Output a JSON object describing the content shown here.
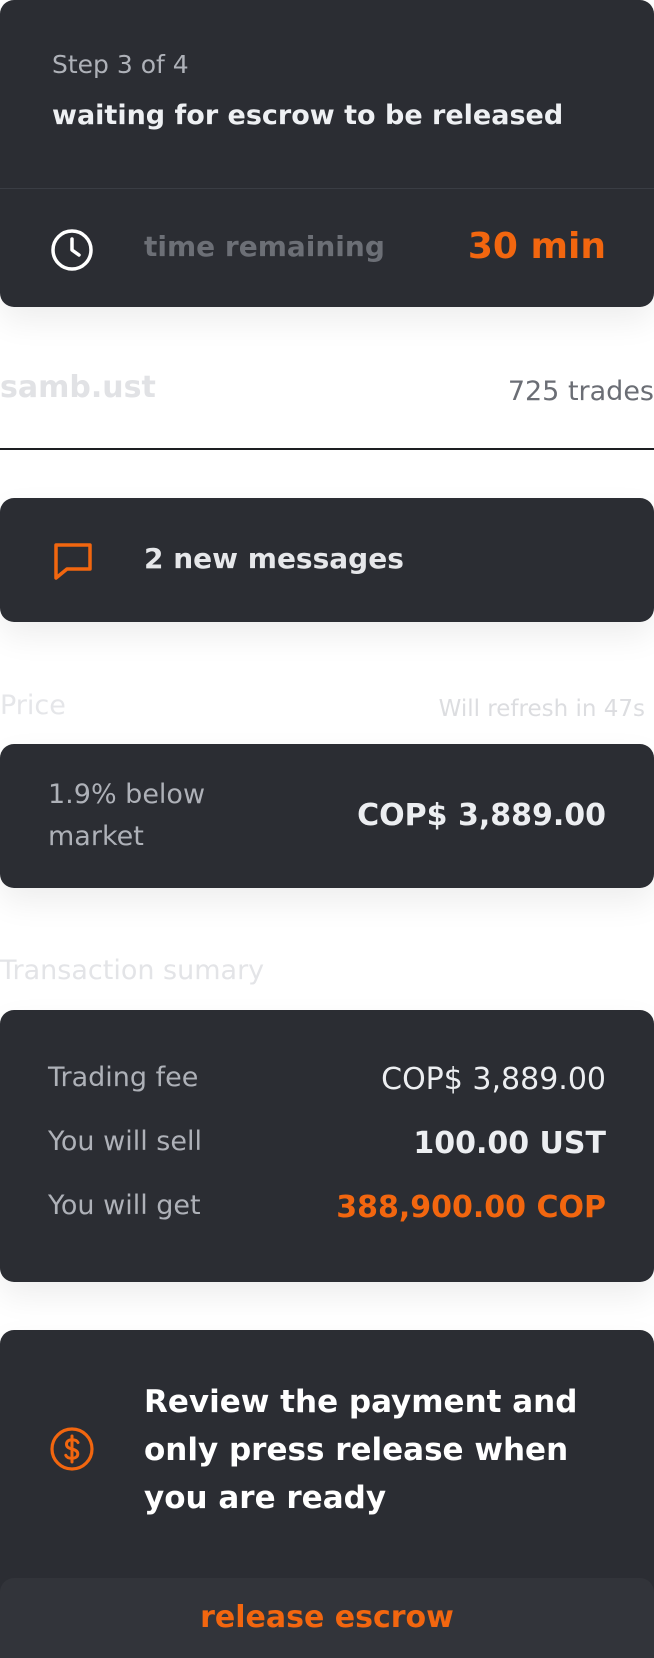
{
  "step": {
    "label": "Step 3 of 4",
    "title": "waiting for escrow to be released",
    "time_label": "time remaining",
    "time_value": "30 min",
    "icon": "clock-icon"
  },
  "trader": {
    "name": "samb.ust",
    "trades": "725 trades"
  },
  "messages": {
    "text": "2 new messages",
    "icon": "message-icon"
  },
  "price": {
    "label": "Price",
    "refresh": "Will refresh in 47s",
    "description": "1.9% below market",
    "value": "COP$ 3,889.00"
  },
  "summary": {
    "label": "Transaction sumary",
    "rows": [
      {
        "label": "Trading fee",
        "value": "COP$ 3,889.00"
      },
      {
        "label": "You will sell",
        "value": "100.00 UST"
      },
      {
        "label": "You will get",
        "value": "388,900.00 COP"
      }
    ]
  },
  "release": {
    "message": "Review the payment and only press release when you are ready",
    "button_label": "release escrow",
    "icon": "dollar-icon"
  },
  "colors": {
    "card_bg": "#2b2d33",
    "accent": "#f2660f"
  }
}
